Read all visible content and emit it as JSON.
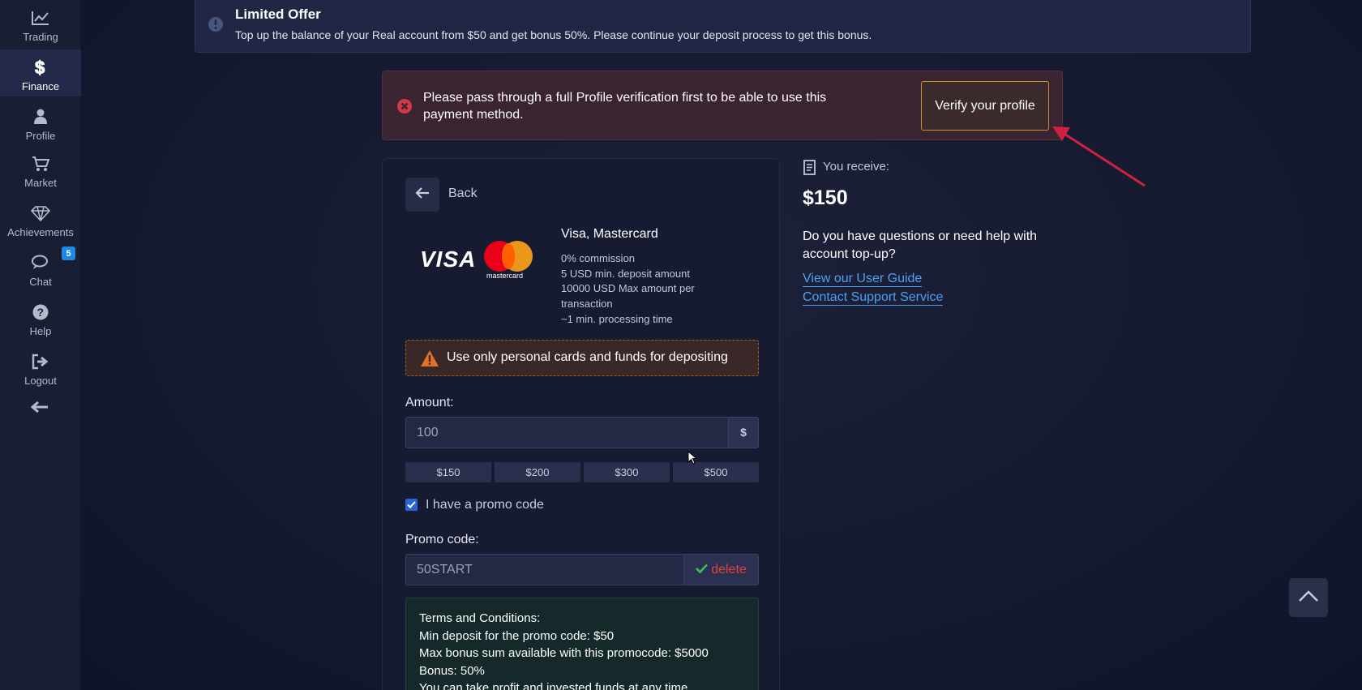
{
  "sidebar": {
    "items": [
      {
        "label": "Trading",
        "icon": "chart-line-icon"
      },
      {
        "label": "Finance",
        "icon": "dollar-icon",
        "active": true
      },
      {
        "label": "Profile",
        "icon": "user-icon"
      },
      {
        "label": "Market",
        "icon": "cart-icon"
      },
      {
        "label": "Achievements",
        "icon": "diamond-icon"
      },
      {
        "label": "Chat",
        "icon": "chat-icon"
      },
      {
        "label": "Help",
        "icon": "question-icon"
      },
      {
        "label": "Logout",
        "icon": "logout-icon"
      }
    ],
    "chat_badge": "5",
    "collapse_icon": "arrow-left-icon"
  },
  "offer": {
    "title": "Limited Offer",
    "text": "Top up the balance of your Real account from $50 and get bonus 50%. Please continue your deposit process to get this bonus."
  },
  "alert": {
    "message": "Please pass through a full Profile verification first to be able to use this payment method.",
    "verify_button": "Verify your profile"
  },
  "deposit": {
    "back_label": "Back",
    "visa_logo": "VISA",
    "mastercard_logo": "mastercard",
    "method_title": "Visa, Mastercard",
    "details": [
      "0% commission",
      "5 USD min. deposit amount",
      "10000 USD Max amount per transaction",
      "~1 min. processing time"
    ],
    "warning": "Use only personal cards and funds for depositing",
    "amount_label": "Amount:",
    "amount_value": "100",
    "amount_currency": "$",
    "quick_amounts": [
      "$150",
      "$200",
      "$300",
      "$500"
    ],
    "promo_checkbox_label": "I have a promo code",
    "promo_checked": true,
    "promo_label": "Promo code:",
    "promo_value": "50START",
    "promo_delete": "delete",
    "terms": [
      "Terms and Conditions:",
      "Min deposit for the promo code: $50",
      "Max bonus sum available with this promocode: $5000",
      "Bonus: 50%",
      "You can take profit and invested funds at any time"
    ]
  },
  "summary": {
    "receive_label": "You receive:",
    "receive_amount": "$150",
    "help_question": "Do you have questions or need help with account top-up?",
    "user_guide_link": "View our User Guide",
    "support_link": "Contact Support Service"
  },
  "colors": {
    "accent_orange": "#d98a2c",
    "link_blue": "#4ea0ef",
    "error_red": "#e83e3e",
    "annotation_arrow": "#d0203f"
  }
}
